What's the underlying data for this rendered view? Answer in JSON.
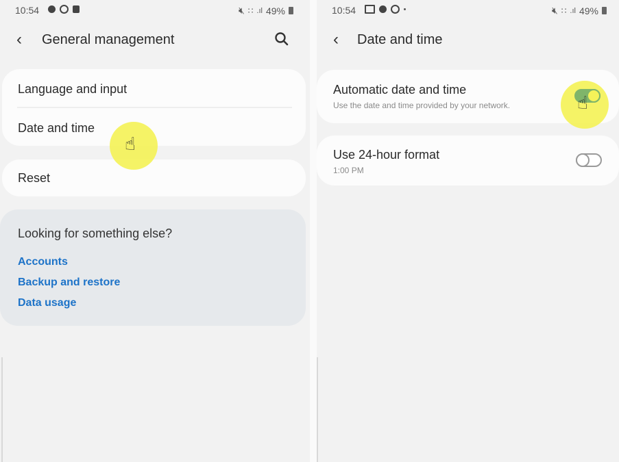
{
  "left_screen": {
    "status_bar": {
      "time": "10:54",
      "notification_icons": [
        "info-dot-icon",
        "sync-ring-icon",
        "square-notification-icon"
      ],
      "battery_percent": "49%",
      "right_icons": [
        "mute-icon",
        "wifi-icon",
        "signal-icon",
        "battery-icon"
      ]
    },
    "header": {
      "back_icon": "back-chevron-icon",
      "title": "General management",
      "search_icon": "search-icon"
    },
    "group1": {
      "items": [
        {
          "label": "Language and input"
        },
        {
          "label": "Date and time"
        }
      ]
    },
    "group2": {
      "items": [
        {
          "label": "Reset"
        }
      ]
    },
    "suggestions": {
      "heading": "Looking for something else?",
      "links": [
        {
          "label": "Accounts"
        },
        {
          "label": "Backup and restore"
        },
        {
          "label": "Data usage"
        }
      ]
    },
    "tap_indicator": {
      "target": "Date and time",
      "icon": "hand-pointer-icon"
    }
  },
  "right_screen": {
    "status_bar": {
      "time": "10:54",
      "notification_icons": [
        "image-icon",
        "info-dot-icon",
        "sync-ring-icon",
        "more-dot-icon"
      ],
      "battery_percent": "49%",
      "right_icons": [
        "mute-icon",
        "wifi-icon",
        "signal-icon",
        "battery-icon"
      ]
    },
    "header": {
      "back_icon": "back-chevron-icon",
      "title": "Date and time"
    },
    "settings": [
      {
        "label": "Automatic date and time",
        "description": "Use the date and time provided by your network.",
        "toggle_on": true
      },
      {
        "label": "Use 24-hour format",
        "description": "1:00 PM",
        "toggle_on": false
      }
    ],
    "tap_indicator": {
      "target": "Automatic date and time toggle",
      "icon": "hand-pointer-icon"
    }
  },
  "colors": {
    "link_blue": "#1d73c8",
    "toggle_green": "#7fb56a",
    "highlight_yellow": "#f4f259",
    "background": "#f2f2f2",
    "card": "#fcfcfc",
    "suggestion_card": "#e6e9ec"
  }
}
